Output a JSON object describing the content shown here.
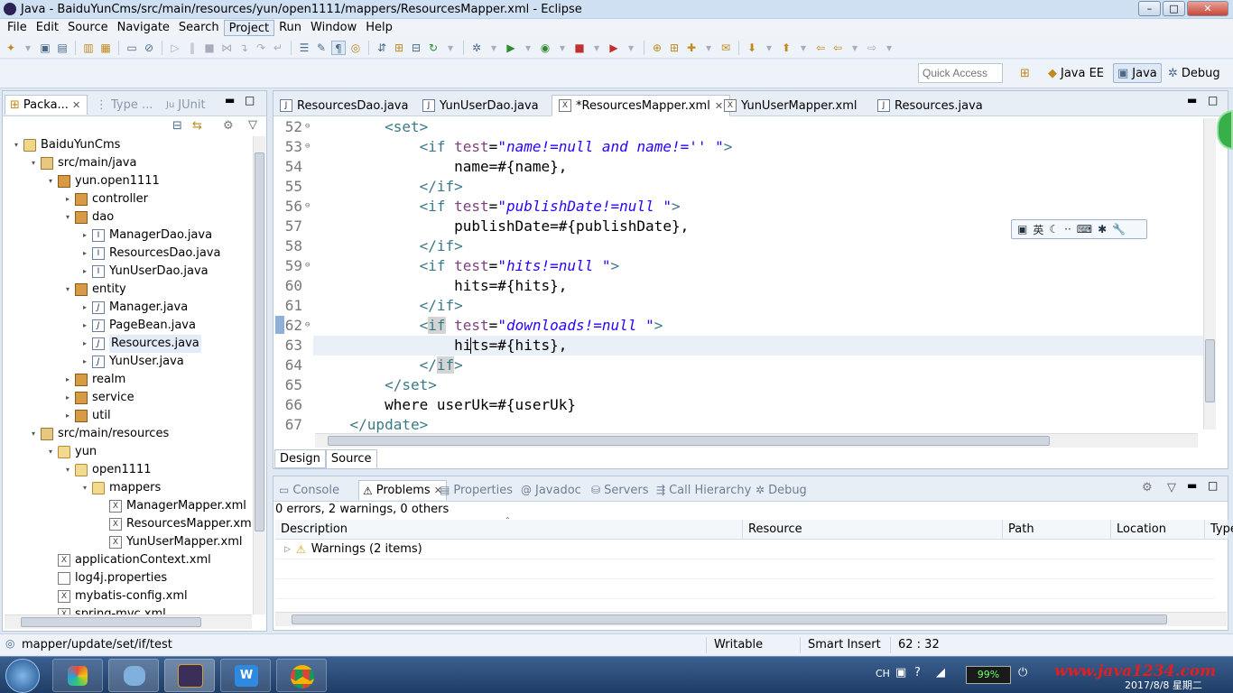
{
  "window": {
    "title": "Java - BaiduYunCms/src/main/resources/yun/open1111/mappers/ResourcesMapper.xml - Eclipse",
    "min": "–",
    "max": "□",
    "close": "✕"
  },
  "menu": [
    "File",
    "Edit",
    "Source",
    "Navigate",
    "Search",
    "Project",
    "Run",
    "Window",
    "Help"
  ],
  "quick_access": {
    "placeholder": "Quick Access"
  },
  "perspectives": [
    {
      "label": "Java EE"
    },
    {
      "label": "Java"
    },
    {
      "label": "Debug"
    }
  ],
  "left_panel": {
    "tabs": [
      {
        "label": "Packa..."
      },
      {
        "label": "Type ..."
      },
      {
        "label": "JUnit"
      }
    ],
    "tree": [
      {
        "label": "BaiduYunCms",
        "icon": "project-icon",
        "depth": 0,
        "arrow": "▾"
      },
      {
        "label": "src/main/java",
        "icon": "source-folder-icon",
        "depth": 1,
        "arrow": "▾"
      },
      {
        "label": "yun.open1111",
        "icon": "package-icon",
        "depth": 2,
        "arrow": "▾"
      },
      {
        "label": "controller",
        "icon": "package-icon",
        "depth": 3,
        "arrow": "▸"
      },
      {
        "label": "dao",
        "icon": "package-icon",
        "depth": 3,
        "arrow": "▾"
      },
      {
        "label": "ManagerDao.java",
        "icon": "interface-file-icon",
        "depth": 4,
        "arrow": "▸"
      },
      {
        "label": "ResourcesDao.java",
        "icon": "interface-file-icon",
        "depth": 4,
        "arrow": "▸"
      },
      {
        "label": "YunUserDao.java",
        "icon": "interface-file-icon",
        "depth": 4,
        "arrow": "▸"
      },
      {
        "label": "entity",
        "icon": "package-icon",
        "depth": 3,
        "arrow": "▾"
      },
      {
        "label": "Manager.java",
        "icon": "java-file-icon",
        "depth": 4,
        "arrow": "▸"
      },
      {
        "label": "PageBean.java",
        "icon": "java-file-icon",
        "depth": 4,
        "arrow": "▸"
      },
      {
        "label": "Resources.java",
        "icon": "java-file-icon",
        "depth": 4,
        "arrow": "▸",
        "selected": true
      },
      {
        "label": "YunUser.java",
        "icon": "java-file-icon",
        "depth": 4,
        "arrow": "▸"
      },
      {
        "label": "realm",
        "icon": "package-icon",
        "depth": 3,
        "arrow": "▸"
      },
      {
        "label": "service",
        "icon": "package-icon",
        "depth": 3,
        "arrow": "▸"
      },
      {
        "label": "util",
        "icon": "package-icon",
        "depth": 3,
        "arrow": "▸"
      },
      {
        "label": "src/main/resources",
        "icon": "source-folder-icon",
        "depth": 1,
        "arrow": "▾"
      },
      {
        "label": "yun",
        "icon": "folder-icon",
        "depth": 2,
        "arrow": "▾"
      },
      {
        "label": "open1111",
        "icon": "folder-icon",
        "depth": 3,
        "arrow": "▾"
      },
      {
        "label": "mappers",
        "icon": "folder-icon",
        "depth": 4,
        "arrow": "▾"
      },
      {
        "label": "ManagerMapper.xml",
        "icon": "xml-file-icon",
        "depth": 5,
        "arrow": ""
      },
      {
        "label": "ResourcesMapper.xml",
        "icon": "xml-file-icon",
        "depth": 5,
        "arrow": ""
      },
      {
        "label": "YunUserMapper.xml",
        "icon": "xml-file-icon",
        "depth": 5,
        "arrow": ""
      },
      {
        "label": "applicationContext.xml",
        "icon": "xml-file-icon",
        "depth": 2,
        "arrow": ""
      },
      {
        "label": "log4j.properties",
        "icon": "properties-file-icon",
        "depth": 2,
        "arrow": ""
      },
      {
        "label": "mybatis-config.xml",
        "icon": "xml-file-icon",
        "depth": 2,
        "arrow": ""
      },
      {
        "label": "spring-mvc.xml",
        "icon": "xml-file-icon",
        "depth": 2,
        "arrow": ""
      }
    ]
  },
  "editor": {
    "tabs": [
      {
        "label": "ResourcesDao.java",
        "active": false
      },
      {
        "label": "YunUserDao.java",
        "active": false
      },
      {
        "label": "*ResourcesMapper.xml",
        "active": true
      },
      {
        "label": "YunUserMapper.xml",
        "active": false
      },
      {
        "label": "Resources.java",
        "active": false
      }
    ],
    "lines": [
      {
        "n": "52",
        "fold": "⊖",
        "html": "        <span class='tag'>&lt;set&gt;</span>"
      },
      {
        "n": "53",
        "fold": "⊖",
        "html": "            <span class='tag'>&lt;if</span> <span class='att'>test</span>=<span class='val'>\"name!=null and name!='' \"</span><span class='tag'>&gt;</span>"
      },
      {
        "n": "54",
        "fold": "",
        "html": "                name=#{name},"
      },
      {
        "n": "55",
        "fold": "",
        "html": "            <span class='tag'>&lt;/if&gt;</span>"
      },
      {
        "n": "56",
        "fold": "⊖",
        "html": "            <span class='tag'>&lt;if</span> <span class='att'>test</span>=<span class='val'>\"publishDate!=null \"</span><span class='tag'>&gt;</span>"
      },
      {
        "n": "57",
        "fold": "",
        "html": "                publishDate=#{publishDate},"
      },
      {
        "n": "58",
        "fold": "",
        "html": "            <span class='tag'>&lt;/if&gt;</span>"
      },
      {
        "n": "59",
        "fold": "⊖",
        "html": "            <span class='tag'>&lt;if</span> <span class='att'>test</span>=<span class='val'>\"hits!=null \"</span><span class='tag'>&gt;</span>"
      },
      {
        "n": "60",
        "fold": "",
        "html": "                hits=#{hits},"
      },
      {
        "n": "61",
        "fold": "",
        "html": "            <span class='tag'>&lt;/if&gt;</span>"
      },
      {
        "n": "62",
        "fold": "⊖",
        "html": "            <span class='tag'>&lt;<span class='hl'>if</span></span> <span class='att'>test</span>=<span class='val'>\"downloads!=null \"</span><span class='tag'>&gt;</span>"
      },
      {
        "n": "63",
        "fold": "",
        "html": "                hits=#{hits},"
      },
      {
        "n": "64",
        "fold": "",
        "html": "            <span class='tag'>&lt;/<span class='hl'>if</span>&gt;</span>"
      },
      {
        "n": "65",
        "fold": "",
        "html": "        <span class='tag'>&lt;/set&gt;</span>"
      },
      {
        "n": "66",
        "fold": "",
        "html": "        where userUk=#{userUk}"
      },
      {
        "n": "67",
        "fold": "",
        "html": "    <span class='tag'>&lt;/update&gt;</span>"
      }
    ],
    "bottom_tabs": [
      {
        "label": "Design"
      },
      {
        "label": "Source"
      }
    ]
  },
  "ime_bar": {
    "lang": "英"
  },
  "bottom_panel": {
    "tabs": [
      {
        "label": "Console",
        "active": false
      },
      {
        "label": "Problems",
        "active": true
      },
      {
        "label": "Properties",
        "active": false
      },
      {
        "label": "Javadoc",
        "active": false
      },
      {
        "label": "Servers",
        "active": false
      },
      {
        "label": "Call Hierarchy",
        "active": false
      },
      {
        "label": "Debug",
        "active": false
      }
    ],
    "summary": "0 errors, 2 warnings, 0 others",
    "columns": [
      "Description",
      "Resource",
      "Path",
      "Location",
      "Type"
    ],
    "rows": [
      {
        "description": "Warnings (2 items)"
      }
    ]
  },
  "status": {
    "breadcrumb": "mapper/update/set/if/test",
    "mode": "Writable",
    "insert": "Smart Insert",
    "position": "62 : 32"
  },
  "taskbar": {
    "battery": "99%",
    "watermark": "www.java1234.com",
    "date": "2017/8/8 星期二",
    "lang": "CH"
  },
  "colors": {
    "tag": "#3a7a87",
    "attr": "#7f3f7f",
    "value": "#2a00ff"
  }
}
